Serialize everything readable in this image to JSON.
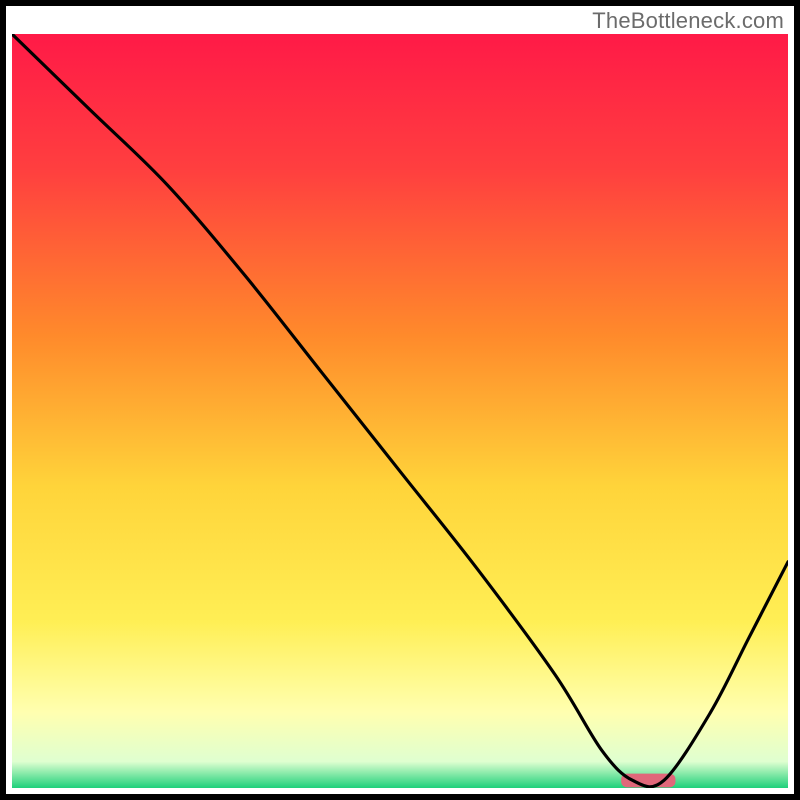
{
  "watermark": "TheBottleneck.com",
  "chart_data": {
    "type": "line",
    "title": "",
    "xlabel": "",
    "ylabel": "",
    "xlim": [
      0,
      100
    ],
    "ylim": [
      0,
      100
    ],
    "gradient_stops": [
      {
        "offset": 0.0,
        "color": "#ff1a47"
      },
      {
        "offset": 0.18,
        "color": "#ff3f3f"
      },
      {
        "offset": 0.4,
        "color": "#ff8a2b"
      },
      {
        "offset": 0.6,
        "color": "#ffd43a"
      },
      {
        "offset": 0.78,
        "color": "#ffef55"
      },
      {
        "offset": 0.9,
        "color": "#ffffb0"
      },
      {
        "offset": 0.965,
        "color": "#dfffd0"
      },
      {
        "offset": 1.0,
        "color": "#1dd07a"
      }
    ],
    "curve": {
      "x": [
        0,
        10,
        20,
        30,
        40,
        50,
        60,
        70,
        76,
        80,
        84,
        90,
        95,
        100
      ],
      "y": [
        100,
        90,
        80,
        68,
        55,
        42,
        29,
        15,
        5,
        1,
        1,
        10,
        20,
        30
      ]
    },
    "marker": {
      "x_center": 82,
      "width": 7,
      "y": 1,
      "color": "#e0677a"
    },
    "comment": "y = 0 is the bottom (optimal). Curve descends from top-left, kinks around x≈20, bottoms out near x≈80-84, then rises."
  }
}
